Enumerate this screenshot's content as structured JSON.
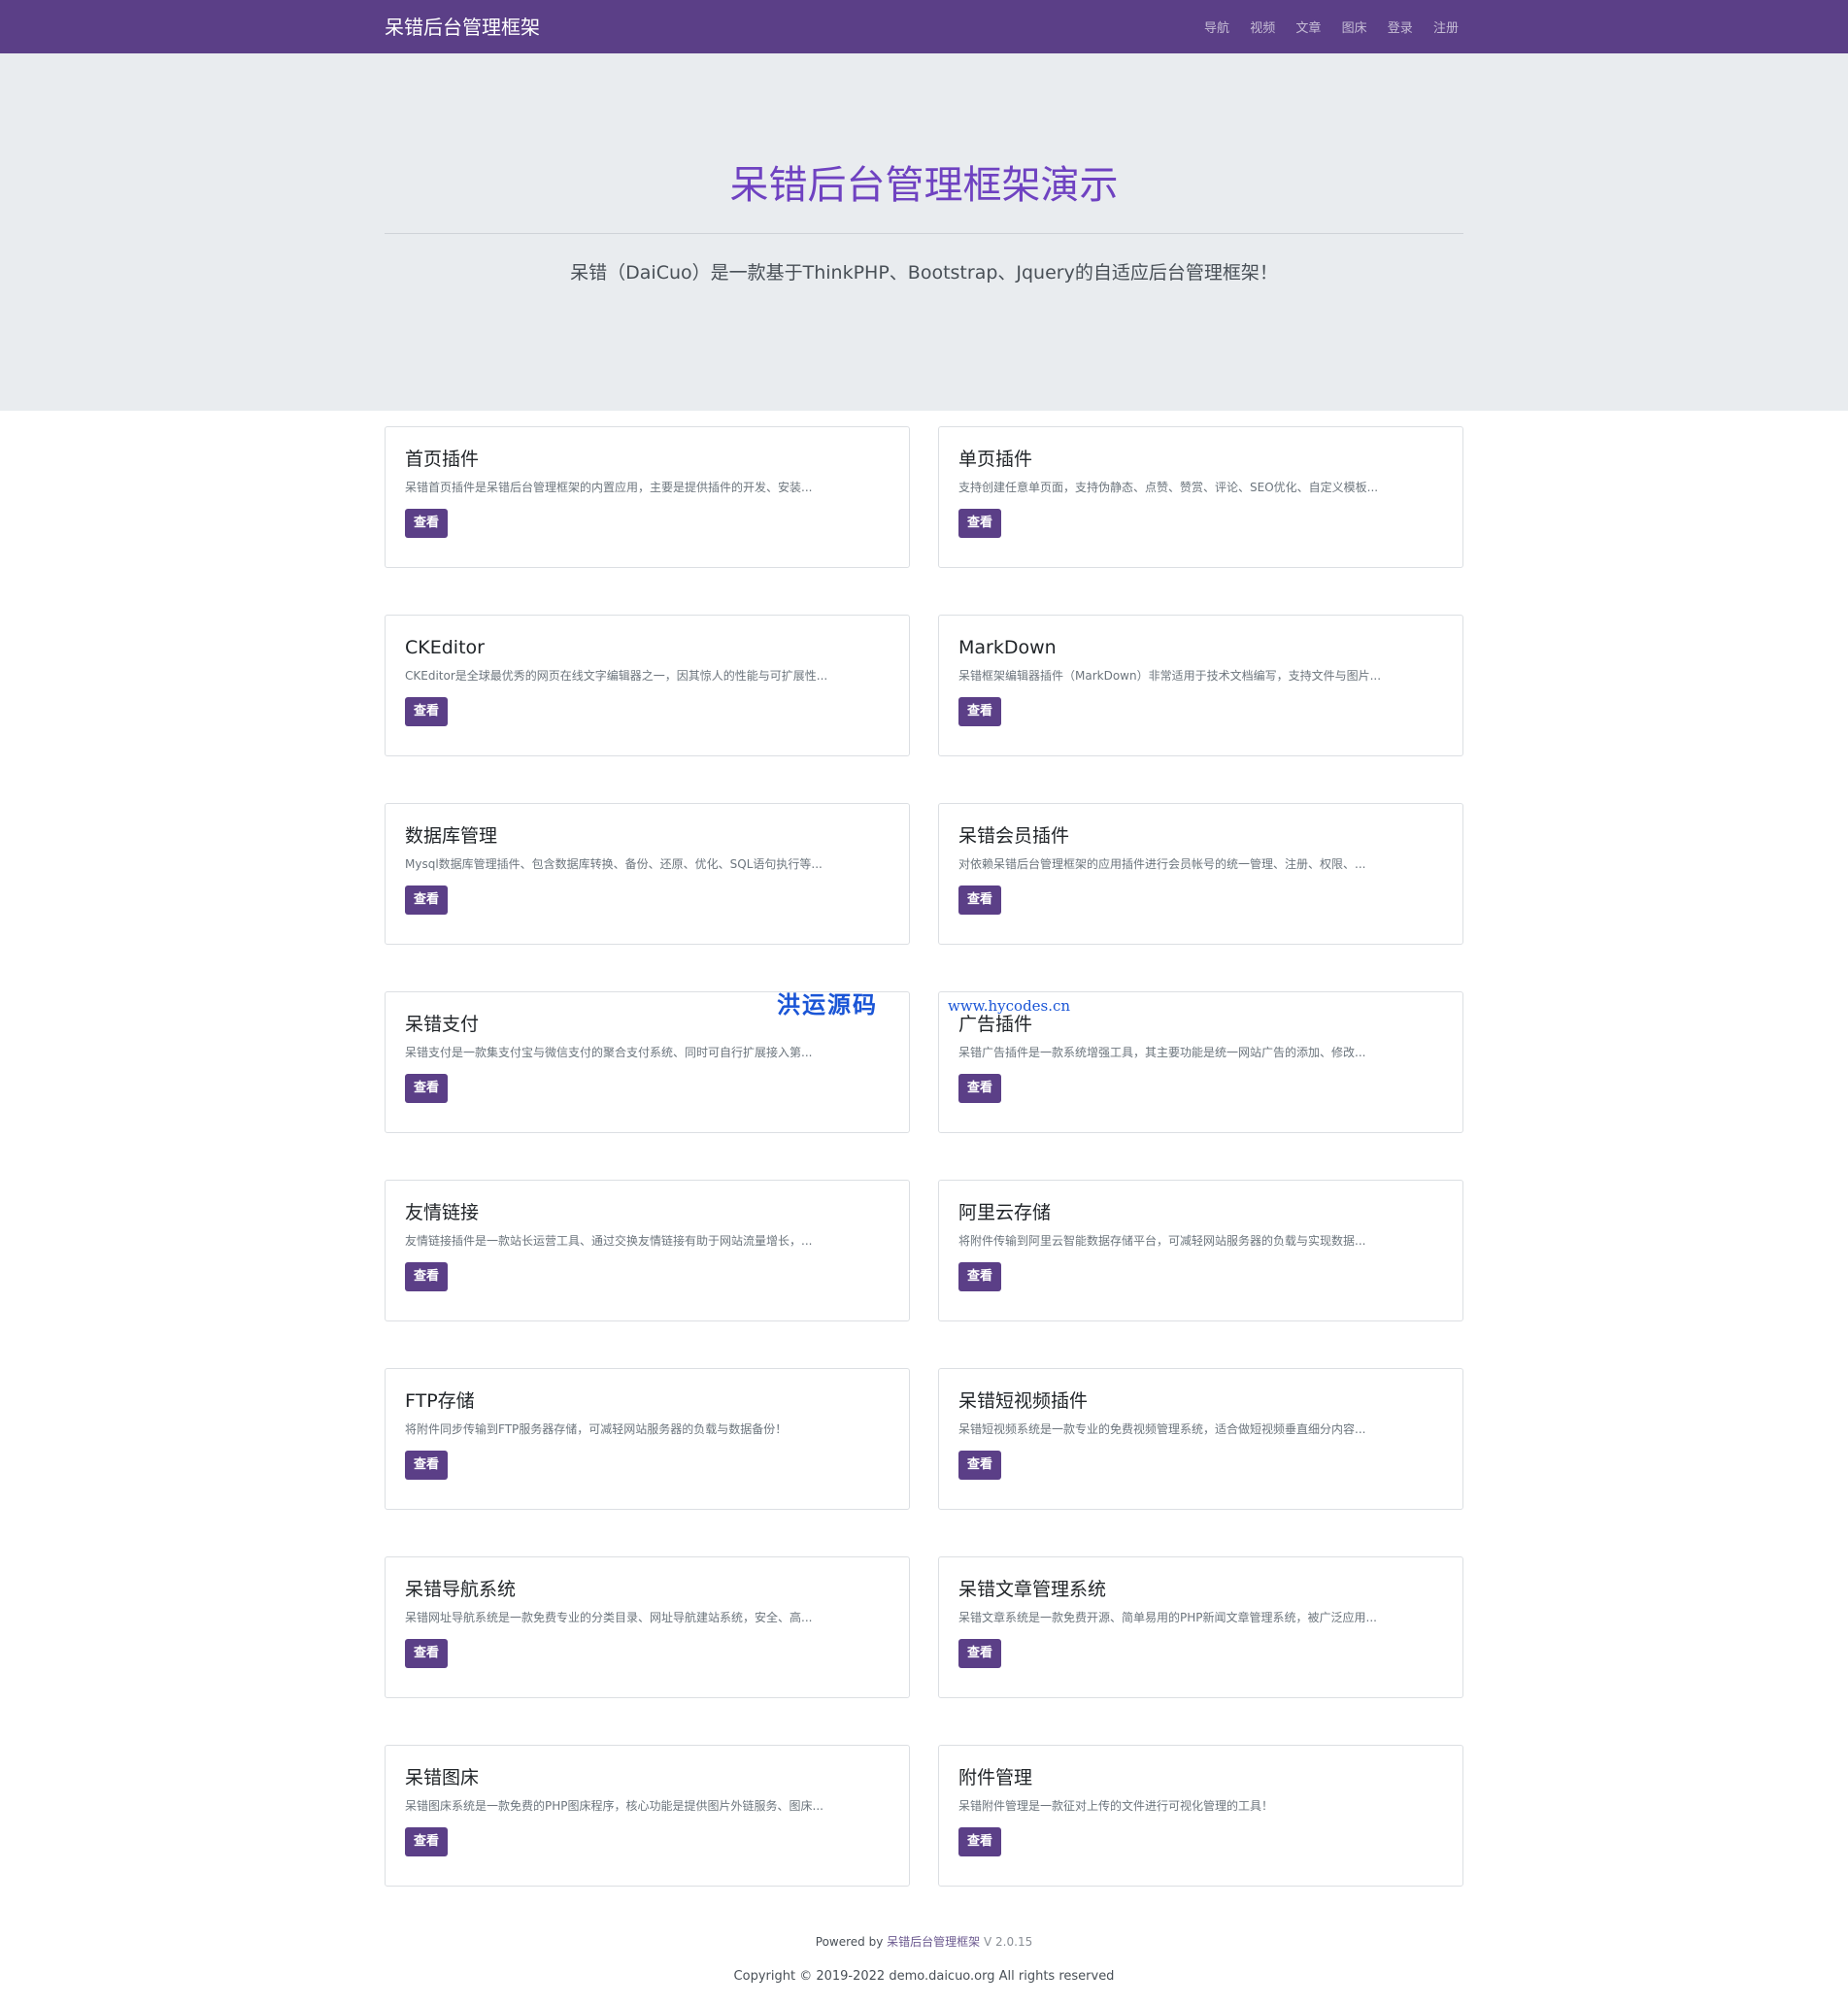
{
  "header": {
    "brand": "呆错后台管理框架",
    "nav": [
      "导航",
      "视频",
      "文章",
      "图床",
      "登录",
      "注册"
    ]
  },
  "hero": {
    "title": "呆错后台管理框架演示",
    "lead": "呆错（DaiCuo）是一款基于ThinkPHP、Bootstrap、Jquery的自适应后台管理框架！"
  },
  "cards": [
    {
      "title": "首页插件",
      "desc": "呆错首页插件是呆错后台管理框架的内置应用，主要是提供插件的开发、安装...",
      "button": "查看"
    },
    {
      "title": "单页插件",
      "desc": "支持创建任意单页面，支持伪静态、点赞、赞赏、评论、SEO优化、自定义模板...",
      "button": "查看"
    },
    {
      "title": "CKEditor",
      "desc": "CKEditor是全球最优秀的网页在线文字编辑器之一，因其惊人的性能与可扩展性...",
      "button": "查看"
    },
    {
      "title": "MarkDown",
      "desc": "呆错框架编辑器插件（MarkDown）非常适用于技术文档编写，支持文件与图片...",
      "button": "查看"
    },
    {
      "title": "数据库管理",
      "desc": "Mysql数据库管理插件、包含数据库转换、备份、还原、优化、SQL语句执行等...",
      "button": "查看"
    },
    {
      "title": "呆错会员插件",
      "desc": "对依赖呆错后台管理框架的应用插件进行会员帐号的统一管理、注册、权限、...",
      "button": "查看"
    },
    {
      "title": "呆错支付",
      "desc": "呆错支付是一款集支付宝与微信支付的聚合支付系统、同时可自行扩展接入第...",
      "button": "查看"
    },
    {
      "title": "广告插件",
      "desc": "呆错广告插件是一款系统增强工具，其主要功能是统一网站广告的添加、修改...",
      "button": "查看"
    },
    {
      "title": "友情链接",
      "desc": "友情链接插件是一款站长运营工具、通过交换友情链接有助于网站流量增长，...",
      "button": "查看"
    },
    {
      "title": "阿里云存储",
      "desc": "将附件传输到阿里云智能数据存储平台，可减轻网站服务器的负载与实现数据...",
      "button": "查看"
    },
    {
      "title": "FTP存储",
      "desc": "将附件同步传输到FTP服务器存储，可减轻网站服务器的负载与数据备份！",
      "button": "查看"
    },
    {
      "title": "呆错短视频插件",
      "desc": "呆错短视频系统是一款专业的免费视频管理系统，适合做短视频垂直细分内容...",
      "button": "查看"
    },
    {
      "title": "呆错导航系统",
      "desc": "呆错网址导航系统是一款免费专业的分类目录、网址导航建站系统，安全、高...",
      "button": "查看"
    },
    {
      "title": "呆错文章管理系统",
      "desc": "呆错文章系统是一款免费开源、简单易用的PHP新闻文章管理系统，被广泛应用...",
      "button": "查看"
    },
    {
      "title": "呆错图床",
      "desc": "呆错图床系统是一款免费的PHP图床程序，核心功能是提供图片外链服务、图床...",
      "button": "查看"
    },
    {
      "title": "附件管理",
      "desc": "呆错附件管理是一款征对上传的文件进行可视化管理的工具！",
      "button": "查看"
    }
  ],
  "watermark": {
    "text": "洪运源码",
    "url": "www.hycodes.cn"
  },
  "footer": {
    "powered_prefix": "Powered by",
    "powered_link": "呆错后台管理框架",
    "version": "V 2.0.15",
    "copyright": "Copyright © 2019-2022 demo.daicuo.org All rights reserved"
  },
  "colors": {
    "navbar": "#5b3f87",
    "hero_bg": "#e9ecef",
    "title_accent": "#6f42c1",
    "button": "#5b3f87",
    "watermark": "#1a55d6"
  }
}
